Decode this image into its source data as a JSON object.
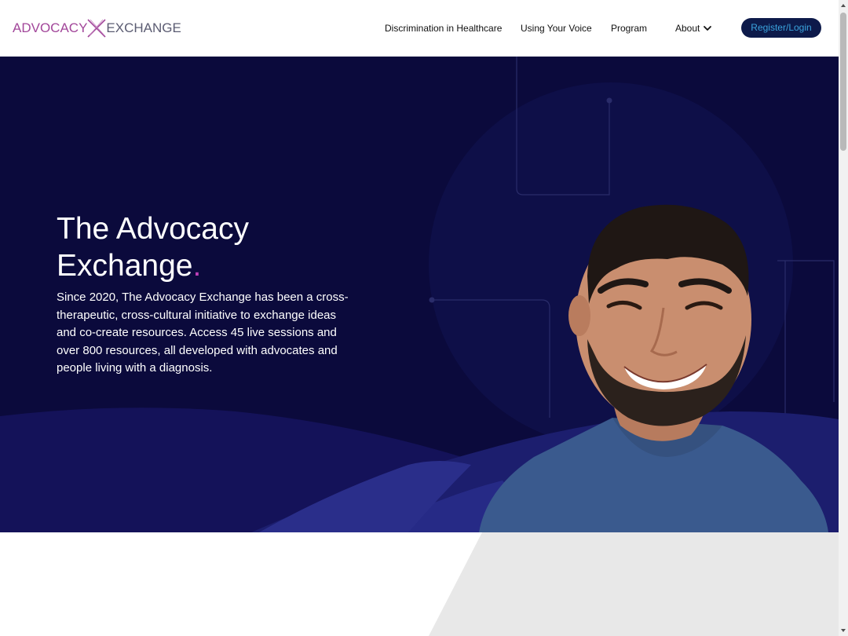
{
  "header": {
    "logo": {
      "left_text": "ADVOCACY",
      "right_text": "EXCHANGE"
    },
    "nav": [
      {
        "label": "Discrimination in Healthcare"
      },
      {
        "label": "Using Your Voice"
      },
      {
        "label": "Program"
      },
      {
        "label": "About"
      }
    ],
    "register_label": "Register/Login"
  },
  "hero": {
    "title_line1": "The Advocacy",
    "title_line2": "Exchange",
    "title_dot": ".",
    "description": "Since 2020, The Advocacy Exchange has been a cross-therapeutic, cross-cultural initiative to exchange ideas and co-create resources. Access 45 live sessions and over 800 resources, all developed with advocates and people living with a diagnosis."
  },
  "colors": {
    "brand_purple": "#a2479a",
    "brand_gray": "#5b5c72",
    "hero_background": "#0b0a3c",
    "button_background": "#0d1a4a",
    "button_text": "#3aa3dd",
    "accent_magenta": "#c040b8"
  },
  "icons": {
    "logo_mark": "x-logo-icon",
    "about_dropdown": "chevron-down-icon",
    "scroll_up": "arrow-up-icon",
    "scroll_down": "arrow-down-icon"
  }
}
